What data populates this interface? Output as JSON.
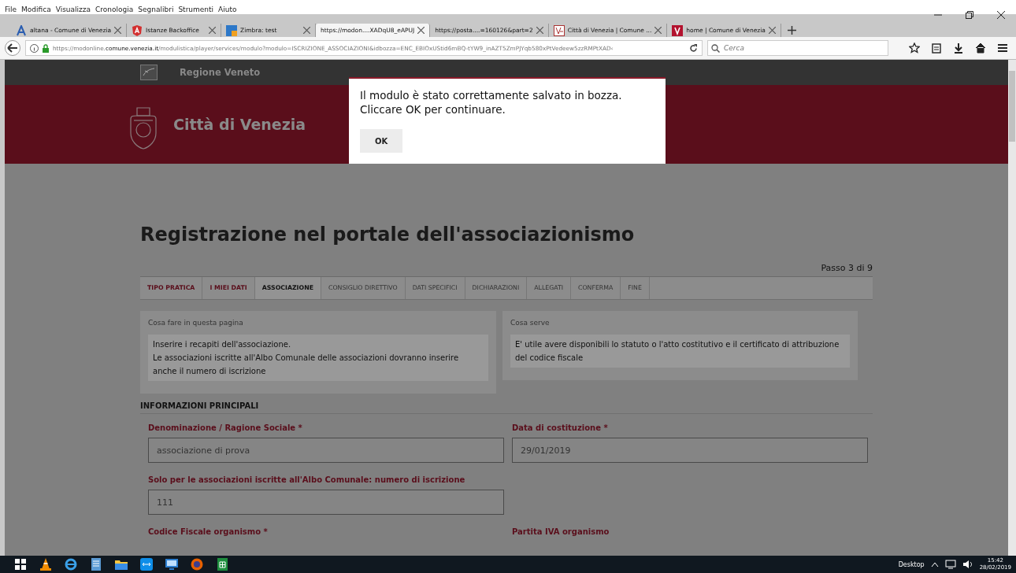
{
  "browser": {
    "menu": [
      "File",
      "Modifica",
      "Visualizza",
      "Cronologia",
      "Segnalibri",
      "Strumenti",
      "Aiuto"
    ],
    "tabs": [
      {
        "title": "altana - Comune di Venezia",
        "selected": false
      },
      {
        "title": "Istanze Backoffice",
        "selected": false
      },
      {
        "title": "Zimbra: test",
        "selected": false
      },
      {
        "title": "https://modon....XADqU8_eAPUJ",
        "selected": true
      },
      {
        "title": "https://posta....=160126&part=2",
        "selected": false
      },
      {
        "title": "Città di Venezia | Comune ...",
        "selected": false
      },
      {
        "title": "home | Comune di Venezia",
        "selected": false
      }
    ],
    "url_host_before": "https://modonline.",
    "url_host": "comune.venezia.it",
    "url_path": "/modulistica/player/services/modulo?modulo=ISCRIZIONE_ASSOCIAZIONI&idbozza=ENC_EBIOxUStid6mBQ-tYW9_inAZT5ZmPJYqb580xPtVedeew5zzRMPtXAD‹",
    "search_placeholder": "Cerca"
  },
  "page": {
    "region": "Regione Veneto",
    "city": "Città di Venezia",
    "title": "Registrazione nel portale dell'associazionismo",
    "step_counter": "Passo 3 di 9",
    "steps": [
      {
        "label": "TIPO PRATICA",
        "completed": true,
        "selected": false
      },
      {
        "label": "I MIEI DATI",
        "completed": true,
        "selected": false
      },
      {
        "label": "ASSOCIAZIONE",
        "completed": false,
        "selected": true
      },
      {
        "label": "CONSIGLIO DIRETTIVO",
        "completed": false,
        "selected": false
      },
      {
        "label": "DATI SPECIFICI",
        "completed": false,
        "selected": false
      },
      {
        "label": "DICHIARAZIONI",
        "completed": false,
        "selected": false
      },
      {
        "label": "ALLEGATI",
        "completed": false,
        "selected": false
      },
      {
        "label": "CONFERMA",
        "completed": false,
        "selected": false
      },
      {
        "label": "FINE",
        "completed": false,
        "selected": false
      }
    ],
    "info_boxes": [
      {
        "heading": "Cosa fare in questa pagina",
        "lines": [
          "Inserire i recapiti dell'associazione.",
          "Le associazioni iscritte all'Albo Comunale delle associazioni dovranno inserire anche il numero di iscrizione"
        ]
      },
      {
        "heading": "Cosa serve",
        "lines": [
          "E' utile avere disponibili lo statuto o l'atto costitutivo e il certificato di attribuzione del codice fiscale"
        ]
      }
    ],
    "section": "INFORMAZIONI PRINCIPALI",
    "field_rows": [
      [
        {
          "label": "Denominazione / Ragione Sociale *",
          "value": "associazione di prova"
        },
        {
          "label": "Data di costituzione *",
          "value": "29/01/2019"
        }
      ],
      [
        {
          "label": "Solo per le associazioni iscritte all'Albo Comunale: numero di iscrizione",
          "value": "111"
        }
      ],
      [
        {
          "label": "Codice Fiscale organismo *"
        },
        {
          "label": "Partita IVA organismo"
        }
      ]
    ]
  },
  "dialog": {
    "message": [
      "Il modulo è stato correttamente salvato in bozza.",
      "Cliccare OK per continuare."
    ],
    "button": "OK"
  },
  "taskbar": {
    "desktop": "Desktop",
    "time": "15:42",
    "date": "28/02/2019"
  }
}
